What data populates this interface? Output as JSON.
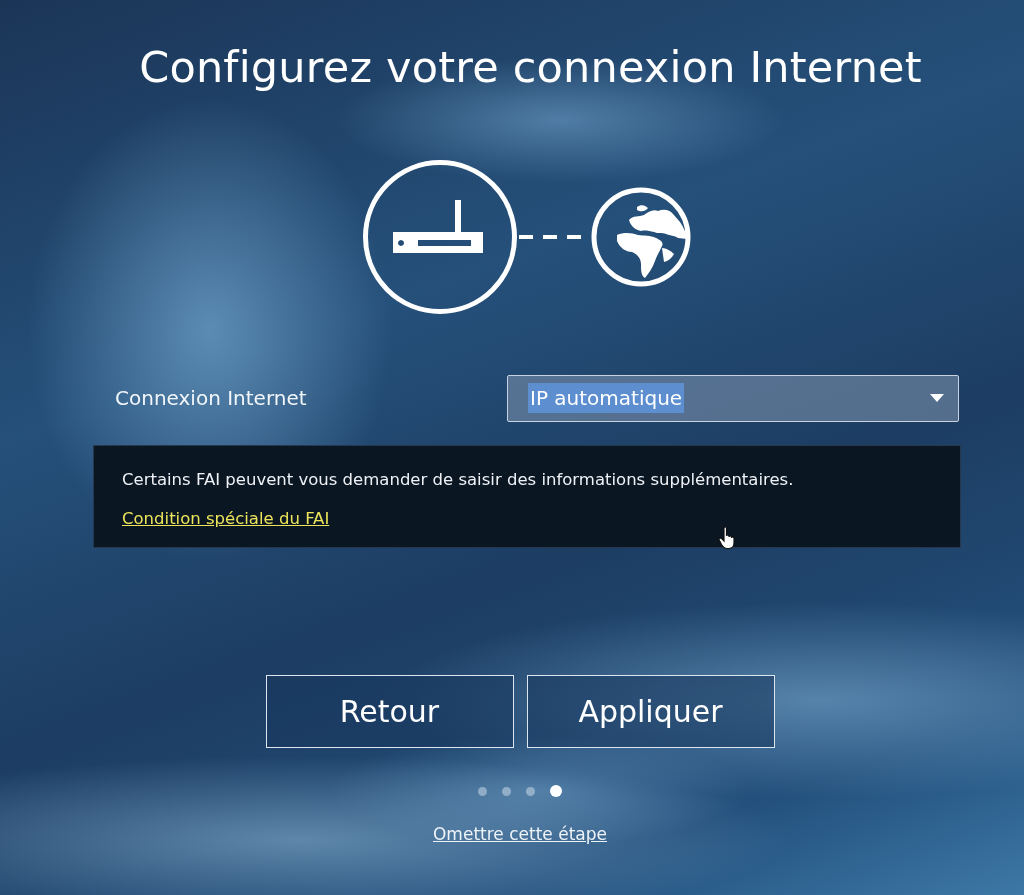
{
  "title": "Configurez votre connexion Internet",
  "connection": {
    "label": "Connexion Internet",
    "value": "IP automatique",
    "value_text_selected": true
  },
  "notice": {
    "text": "Certains FAI peuvent vous demander de saisir des informations supplémentaires.",
    "link": "Condition spéciale du FAI"
  },
  "buttons": [
    "Retour",
    "Appliquer"
  ],
  "steps": [
    {
      "selected": false
    },
    {
      "selected": false
    },
    {
      "selected": false
    },
    {
      "selected": true
    }
  ],
  "skip_link": "Omettre cette étape"
}
